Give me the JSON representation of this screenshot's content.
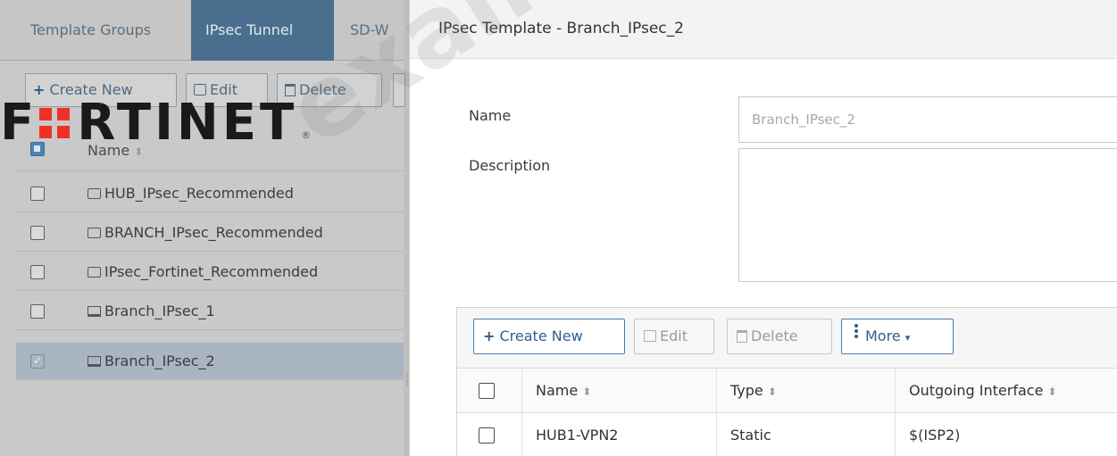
{
  "left_panel": {
    "tabs": [
      {
        "label": "Template Groups"
      },
      {
        "label": "IPsec Tunnel"
      },
      {
        "label": "SD-W"
      }
    ],
    "toolbar": {
      "create_label": "Create New",
      "edit_label": "Edit",
      "delete_label": "Delete"
    },
    "table": {
      "header_name": "Name",
      "sort_glyph": "⬍",
      "rows": [
        {
          "name": "HUB_IPsec_Recommended",
          "icon": "template-icon",
          "checked": false
        },
        {
          "name": "BRANCH_IPsec_Recommended",
          "icon": "template-icon",
          "checked": false
        },
        {
          "name": "IPsec_Fortinet_Recommended",
          "icon": "template-icon",
          "checked": false
        },
        {
          "name": "Branch_IPsec_1",
          "icon": "device-icon",
          "checked": false
        },
        {
          "name": "Branch_IPsec_2",
          "icon": "device-icon",
          "checked": true
        }
      ]
    }
  },
  "logo": {
    "text": "RTINET",
    "brand_color": "#ee3124"
  },
  "dialog": {
    "title": "IPsec Template - Branch_IPsec_2",
    "name_label": "Name",
    "name_value": "Branch_IPsec_2",
    "description_label": "Description",
    "description_value": "",
    "toolbar": {
      "create_label": "Create New",
      "edit_label": "Edit",
      "delete_label": "Delete",
      "more_label": "More"
    },
    "table": {
      "columns": [
        "Name",
        "Type",
        "Outgoing Interface"
      ],
      "rows": [
        {
          "name": "HUB1-VPN2",
          "type": "Static",
          "outgoing_interface": "$(ISP2)"
        }
      ]
    }
  },
  "watermark": "examsrevie"
}
